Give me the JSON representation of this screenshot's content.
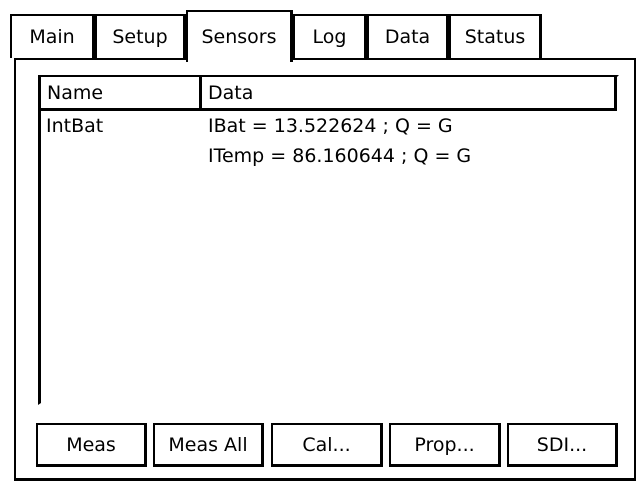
{
  "tabs": [
    {
      "label": "Main",
      "active": false
    },
    {
      "label": "Setup",
      "active": false
    },
    {
      "label": "Sensors",
      "active": true
    },
    {
      "label": "Log",
      "active": false
    },
    {
      "label": "Data",
      "active": false
    },
    {
      "label": "Status",
      "active": false
    }
  ],
  "sensors_list": {
    "columns": [
      "Name",
      "Data"
    ],
    "rows": [
      {
        "name": "IntBat",
        "data": "IBat = 13.522624 ; Q = G"
      },
      {
        "name": "",
        "data": "ITemp = 86.160644 ; Q = G"
      }
    ]
  },
  "buttons": {
    "meas": "Meas",
    "meas_all": "Meas All",
    "cal": "Cal...",
    "prop": "Prop...",
    "sdi": "SDI..."
  }
}
